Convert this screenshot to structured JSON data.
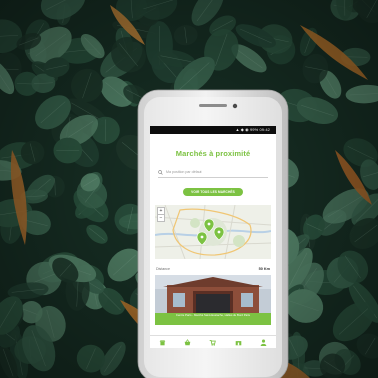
{
  "status_bar": {
    "text": "▲ ◆ ◉ 99% 09:42"
  },
  "header": {
    "title": "Marchés à proximité"
  },
  "search": {
    "placeholder": "Ma position par défaut"
  },
  "cta": {
    "label": "VOIR TOUS LES MARCHÉS"
  },
  "distance": {
    "label": "Distance",
    "value": "50 Km"
  },
  "market_card": {
    "caption": "Centre Paris - Marché Saint-Eustache, Halles du Bord Paris"
  },
  "tabs": [
    {
      "icon": "market-icon"
    },
    {
      "icon": "basket-icon"
    },
    {
      "icon": "cart-icon"
    },
    {
      "icon": "store-icon"
    },
    {
      "icon": "user-icon"
    }
  ],
  "colors": {
    "brand_green": "#7cc242",
    "leaf_dark": "#1f3a2d",
    "leaf_mid": "#2f5a44",
    "leaf_light": "#5b8e72",
    "orange_leaf": "#c07a2e",
    "phone_body": "#e6e6e6"
  }
}
